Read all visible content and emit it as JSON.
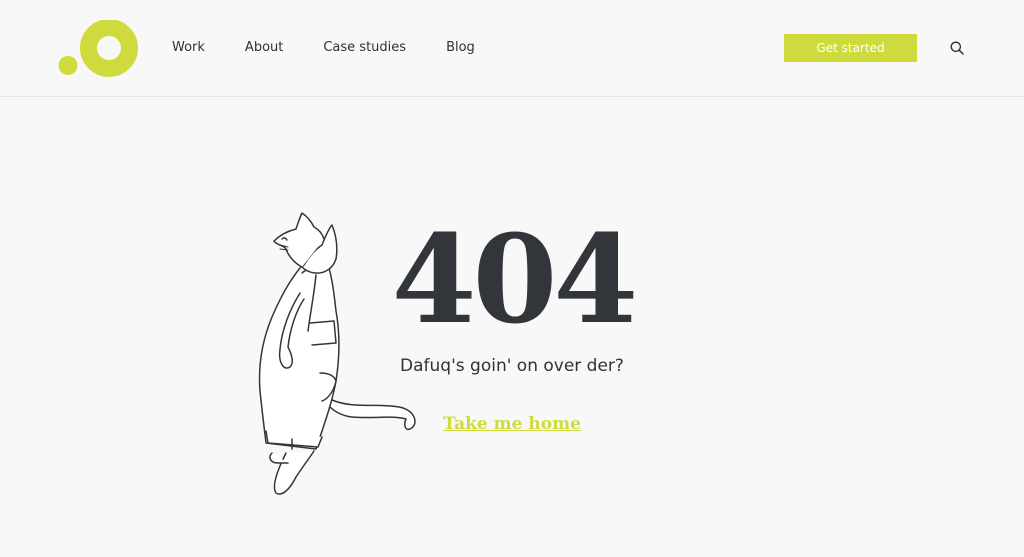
{
  "brand": {
    "accent_color": "#cfdb3c",
    "text_color": "#32363a"
  },
  "nav": {
    "items": [
      {
        "label": "Work"
      },
      {
        "label": "About"
      },
      {
        "label": "Case studies"
      },
      {
        "label": "Blog"
      }
    ]
  },
  "header": {
    "cta_label": "Get started",
    "search_icon": "search-icon"
  },
  "error": {
    "code": "404",
    "message": "Dafuq's goin' on over der?",
    "home_link": "Take me home"
  }
}
